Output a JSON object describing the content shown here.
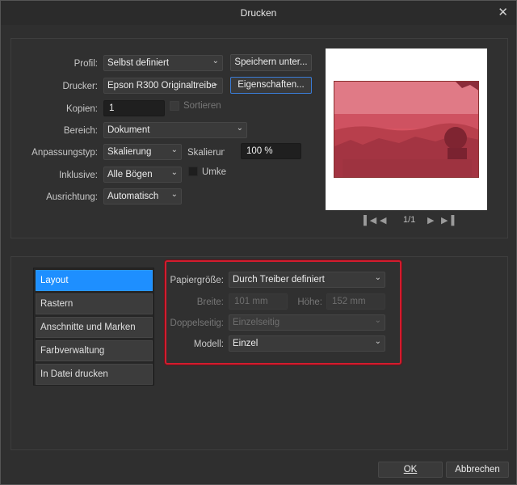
{
  "window": {
    "title": "Drucken",
    "close_glyph": "✕"
  },
  "form": {
    "profil": {
      "label": "Profil:",
      "value": "Selbst definiert"
    },
    "save_button": "Speichern unter...",
    "drucker": {
      "label": "Drucker:",
      "value": "Epson R300 Originaltreibe"
    },
    "properties_button": "Eigenschaften...",
    "kopien": {
      "label": "Kopien:",
      "value": "1"
    },
    "sortieren": {
      "label": "Sortieren",
      "checked": false,
      "enabled": false
    },
    "bereich": {
      "label": "Bereich:",
      "value": "Dokument"
    },
    "anpassungstyp": {
      "label": "Anpassungstyp:",
      "value": "Skalierung"
    },
    "skalierung": {
      "label": "Skalierung",
      "value": "100 %"
    },
    "inklusive": {
      "label": "Inklusive:",
      "value": "Alle Bögen"
    },
    "umkehren": {
      "label": "Umke",
      "checked": false
    },
    "ausrichtung": {
      "label": "Ausrichtung:",
      "value": "Automatisch"
    }
  },
  "preview": {
    "page_indicator": "1/1",
    "tint_color": "#e0394a"
  },
  "tabs": [
    {
      "label": "Layout",
      "active": true
    },
    {
      "label": "Rastern",
      "active": false
    },
    {
      "label": "Anschnitte und Marken",
      "active": false
    },
    {
      "label": "Farbverwaltung",
      "active": false
    },
    {
      "label": "In Datei drucken",
      "active": false
    }
  ],
  "layout": {
    "papiergroesse": {
      "label": "Papiergröße:",
      "value": "Durch Treiber definiert"
    },
    "breite": {
      "label": "Breite:",
      "value": "101 mm"
    },
    "hoehe": {
      "label": "Höhe:",
      "value": "152 mm"
    },
    "doppelseitig": {
      "label": "Doppelseitig:",
      "value": "Einzelseitig"
    },
    "modell": {
      "label": "Modell:",
      "value": "Einzel"
    }
  },
  "footer": {
    "ok": "OK",
    "cancel": "Abbrechen"
  },
  "colors": {
    "accent": "#1e8fff",
    "highlight_frame": "#d11d2f"
  },
  "icons": {
    "first_page": "first-page-icon",
    "prev_page": "prev-page-icon",
    "next_page": "next-page-icon",
    "last_page": "last-page-icon",
    "dropdown": "chevron-down-icon"
  }
}
